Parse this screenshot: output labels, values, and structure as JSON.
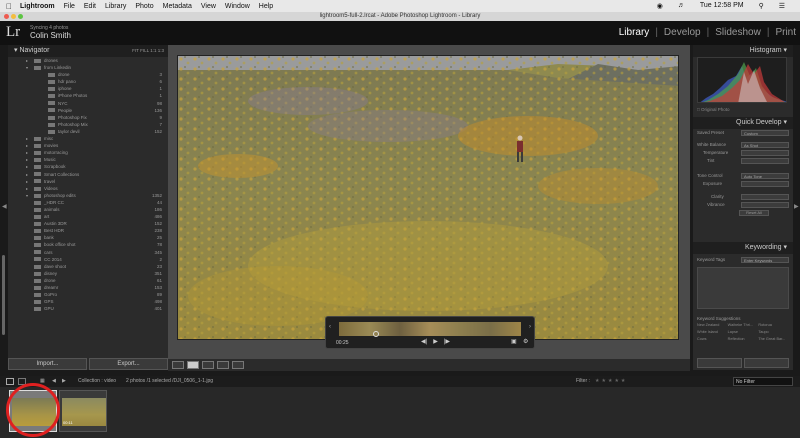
{
  "mac_menu": {
    "app": "Lightroom",
    "items": [
      "File",
      "Edit",
      "Library",
      "Photo",
      "Metadata",
      "View",
      "Window",
      "Help"
    ],
    "clock": "Tue 12:58 PM"
  },
  "window_title": "lightroom5-full-2.lrcat - Adobe Photoshop Lightroom - Library",
  "identity": {
    "logo": "Lr",
    "subtitle": "Syncing 4 photos",
    "name": "Colin Smith"
  },
  "modules": [
    "Library",
    "Develop",
    "Slideshow",
    "Print"
  ],
  "active_module": "Library",
  "navigator": {
    "title": "Navigator",
    "zoom": [
      "FIT",
      "FILL",
      "1:1",
      "1:3"
    ]
  },
  "folders": [
    {
      "label": "drones",
      "count": ""
    },
    {
      "label": "from Linkedin",
      "count": ""
    },
    {
      "label": "drone",
      "count": "3"
    },
    {
      "label": "hdr pano",
      "count": "6"
    },
    {
      "label": "iphone",
      "count": "1"
    },
    {
      "label": "iPhone Photos",
      "count": "1"
    },
    {
      "label": "NYC",
      "count": "98"
    },
    {
      "label": "People",
      "count": "136"
    },
    {
      "label": "Photoshop Fix",
      "count": "9"
    },
    {
      "label": "Photoshop Mix",
      "count": "7"
    },
    {
      "label": "taylor devil",
      "count": "152"
    },
    {
      "label": "misc",
      "count": ""
    },
    {
      "label": "movies",
      "count": ""
    },
    {
      "label": "motorracing",
      "count": ""
    },
    {
      "label": "Music",
      "count": ""
    },
    {
      "label": "Scrapbook",
      "count": ""
    },
    {
      "label": "Smart Collections",
      "count": ""
    },
    {
      "label": "travel",
      "count": ""
    },
    {
      "label": "Videos",
      "count": ""
    },
    {
      "label": "photoshop edits",
      "count": "1352"
    },
    {
      "label": "_HDR CC",
      "count": "44"
    },
    {
      "label": "animals",
      "count": "186"
    },
    {
      "label": "art",
      "count": "486"
    },
    {
      "label": "Austin 3DR",
      "count": "152"
    },
    {
      "label": "Best HDR",
      "count": "238"
    },
    {
      "label": "bank",
      "count": "25"
    },
    {
      "label": "book office shot",
      "count": "78"
    },
    {
      "label": "cars",
      "count": "345"
    },
    {
      "label": "CC 2014",
      "count": "2"
    },
    {
      "label": "dave shoot",
      "count": "23"
    },
    {
      "label": "disney",
      "count": "351"
    },
    {
      "label": "drone",
      "count": "61"
    },
    {
      "label": "dreamr",
      "count": "153"
    },
    {
      "label": "GoPro",
      "count": "89"
    },
    {
      "label": "GPS",
      "count": "498"
    },
    {
      "label": "GPU",
      "count": "401"
    }
  ],
  "left_buttons": {
    "import": "Import...",
    "export": "Export..."
  },
  "video": {
    "time": "00:25"
  },
  "histogram": {
    "title": "Histogram",
    "original_photo": "Original Photo"
  },
  "quick_develop": {
    "title": "Quick Develop",
    "saved_preset": "Saved Preset",
    "saved_preset_value": "Custom",
    "white_balance": "White Balance",
    "white_balance_value": "As Shot",
    "temperature": "Temperature",
    "tint": "Tint",
    "tone_control": "Tone Control",
    "tone_control_value": "Auto Tone",
    "exposure": "Exposure",
    "clarity": "Clarity",
    "vibrance": "Vibrance",
    "reset_all": "Reset All"
  },
  "keywording": {
    "title": "Keywording",
    "keyword_tags": "Keyword Tags",
    "keyword_tags_value": "Enter Keywords",
    "suggestions_title": "Keyword Suggestions",
    "suggestions": [
      "New Zealand",
      "Waiheke Thri...",
      "Rotorua",
      "White Island",
      "Lapse",
      "Taupo",
      "Cows",
      "Reflection",
      "The Great Bar..."
    ]
  },
  "filmstrip_bar": {
    "collection": "Collection : video",
    "selection": "2 photos /1 selected /DJI_0506_1-1.jpg",
    "filter_label": "Filter :",
    "filter_value": "No Filter"
  },
  "filmstrip": {
    "thumb2_duration": "00:11"
  }
}
